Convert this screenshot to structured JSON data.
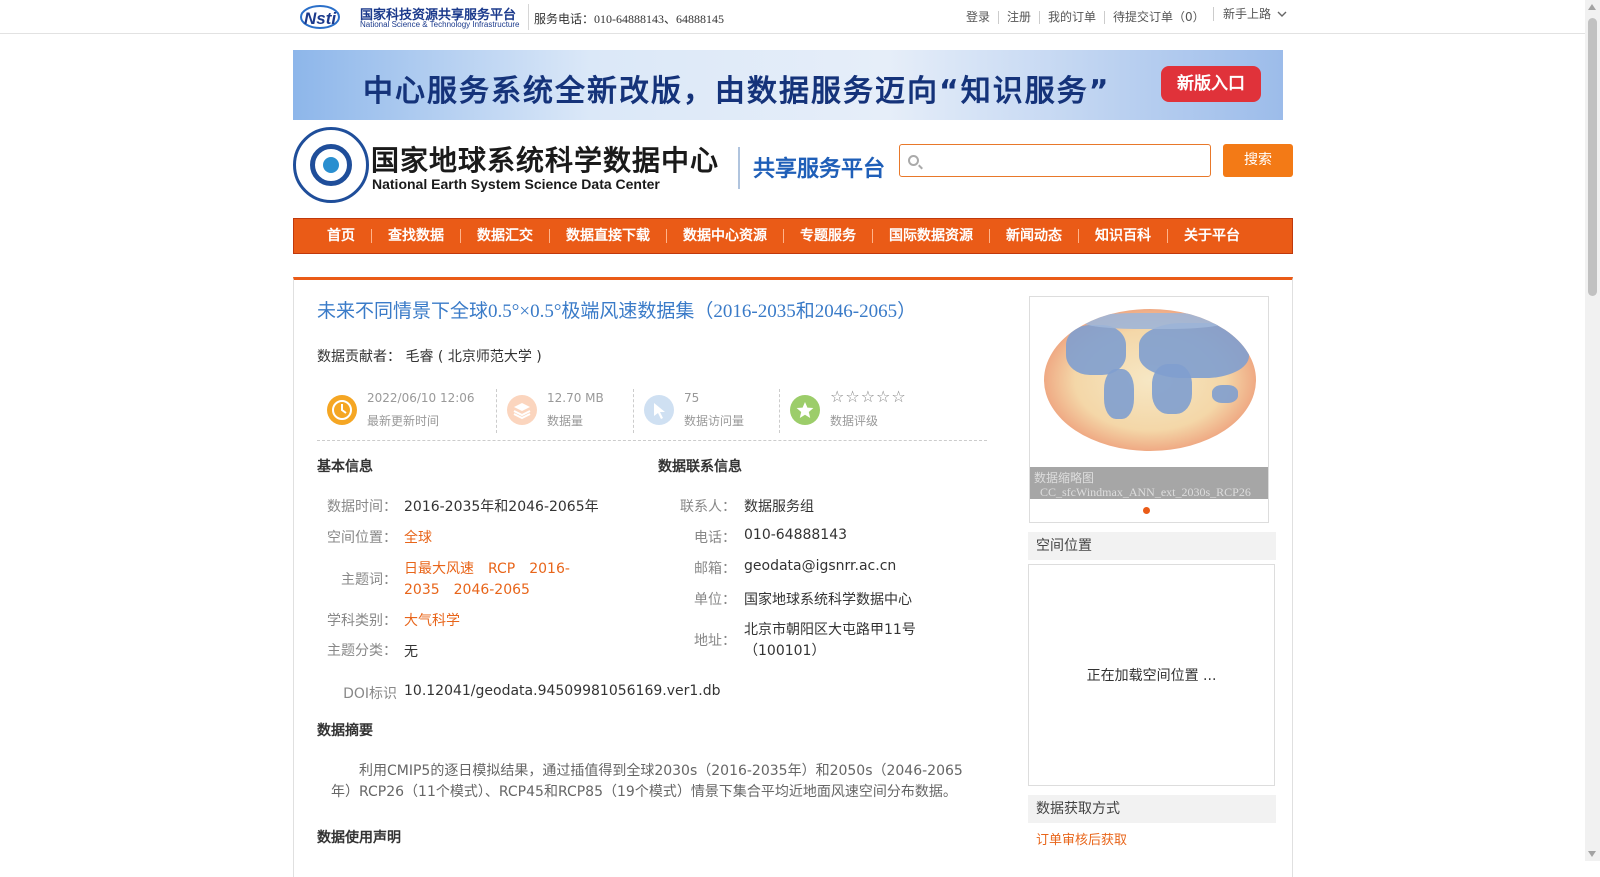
{
  "topbar": {
    "logo_cn": "国家科技资源共享服务平台",
    "logo_en": "National Science & Technology Infrastructure",
    "phone": "服务电话：010-64888143、64888145",
    "links": [
      "登录",
      "注册",
      "我的订单",
      "待提交订单（0）"
    ],
    "guide": "新手上路"
  },
  "banner": {
    "text": "中心服务系统全新改版，由数据服务迈向“知识服务”",
    "button": "新版入口"
  },
  "header": {
    "logo_cn": "国家地球系统科学数据中心",
    "logo_en": "National Earth System Science Data Center",
    "subtitle": "共享服务平台",
    "search_placeholder": "",
    "search_button": "搜索"
  },
  "nav": {
    "items": [
      "首页",
      "查找数据",
      "数据汇交",
      "数据直接下载",
      "数据中心资源",
      "专题服务",
      "国际数据资源",
      "新闻动态",
      "知识百科",
      "关于平台"
    ]
  },
  "dataset": {
    "title": "未来不同情景下全球0.5°×0.5°极端风速数据集（2016-2035和2046-2065）",
    "contributor_label": "数据贡献者：",
    "contributor": "毛睿 ( 北京师范大学 )",
    "stats": {
      "updated": "2022/06/10 12:06",
      "updated_label": "最新更新时间",
      "size": "12.70 MB",
      "size_label": "数据量",
      "visits": "75",
      "visits_label": "数据访问量",
      "rating_stars": "☆☆☆☆☆",
      "rating_label": "数据评级"
    },
    "basic": {
      "heading": "基本信息",
      "time_label": "数据时间：",
      "time": "2016-2035年和2046-2065年",
      "space_label": "空间位置：",
      "space": "全球",
      "keywords_label": "主题词：",
      "keywords_line1": "日最大风速　RCP　2016-",
      "keywords_line2": "2035　2046-2065",
      "discipline_label": "学科类别：",
      "discipline": "大气科学",
      "category_label": "主题分类：",
      "category": "无",
      "doi_label": "DOI标识",
      "doi": "10.12041/geodata.94509981056169.ver1.db"
    },
    "contact": {
      "heading": "数据联系信息",
      "person_label": "联系人：",
      "person": "数据服务组",
      "phone_label": "电话：",
      "phone": "010-64888143",
      "email_label": "邮箱：",
      "email": "geodata@igsnrr.ac.cn",
      "unit_label": "单位：",
      "unit": "国家地球系统科学数据中心",
      "address_label": "地址：",
      "address_line1": "北京市朝阳区大屯路甲11号",
      "address_line2": "（100101）"
    },
    "abstract_heading": "数据摘要",
    "abstract": "利用CMIP5的逐日模拟结果，通过插值得到全球2030s（2016-2035年）和2050s（2046-2065年）RCP26（11个模式）、RCP45和RCP85（19个模式）情景下集合平均近地面风速空间分布数据。",
    "usage_heading": "数据使用声明"
  },
  "sidebar": {
    "thumb_label": "数据缩略图",
    "thumb_file": "CC_sfcWindmax_ANN_ext_2030s_RCP26",
    "space_heading": "空间位置",
    "space_loading": "正在加载空间位置 ...",
    "access_heading": "数据获取方式",
    "access_link": "订单审核后获取"
  },
  "colors": {
    "accent": "#ea5b17",
    "title_blue": "#3a7bc8",
    "link_orange": "#e8651a"
  }
}
